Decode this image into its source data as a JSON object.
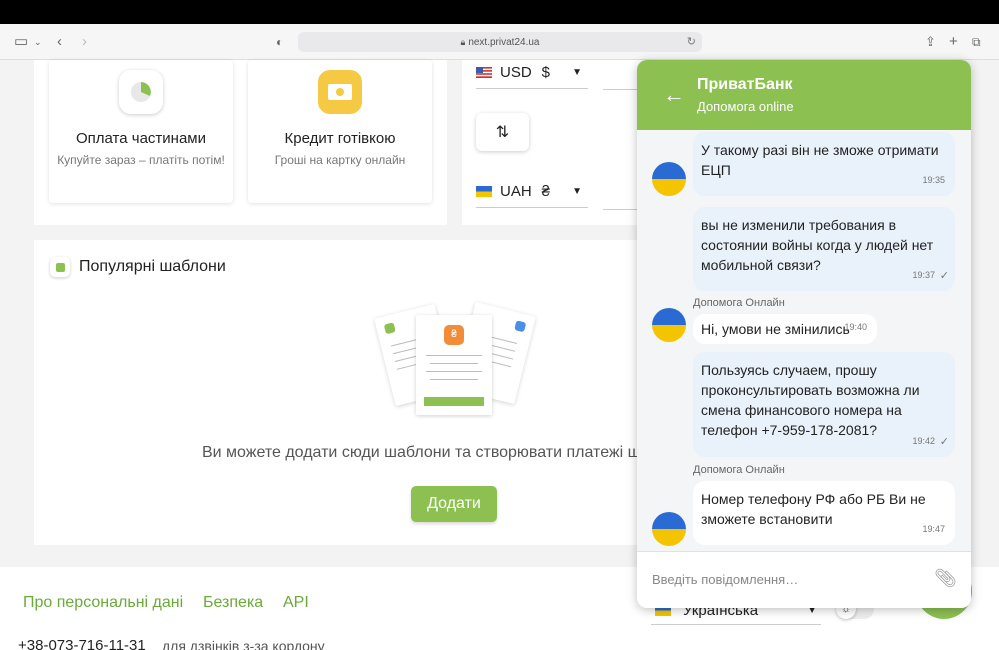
{
  "browser": {
    "url": "next.privat24.ua"
  },
  "cards": [
    {
      "title": "Оплата частинами",
      "subtitle": "Купуйте зараз – платіть потім!"
    },
    {
      "title": "Кредит готівкою",
      "subtitle": "Гроші на картку онлайн"
    }
  ],
  "converter": {
    "from_currency": "USD",
    "from_symbol": "$",
    "to_currency": "UAH",
    "to_symbol": "₴"
  },
  "templates": {
    "title": "Популярні шаблони",
    "empty_text": "Ви можете додати сюди шаблони та створювати платежі ще",
    "add_label": "Додати"
  },
  "footer": {
    "links": [
      "Про персональні дані",
      "Безпека",
      "API"
    ],
    "phone": "+38-073-716-11-31",
    "phone_note": "для дзвінків з-за кордону",
    "language": "Українська"
  },
  "chat": {
    "title": "ПриватБанк",
    "subtitle": "Допомога online",
    "messages": [
      {
        "text": "У такому разі він не зможе отримати ЕЦП",
        "time": "19:35",
        "sender": ""
      },
      {
        "text": "вы не изменили требования в состоянии войны когда у людей нет мобильной связи?",
        "time": "19:37",
        "sender": ""
      },
      {
        "text": "Ні, умови не змінились",
        "time": "19:40",
        "sender": "Допомога Онлайн"
      },
      {
        "text": "Пользуясь случаем, прошу проконсультировать возможна ли смена финансового номера на телефон +7-959-178-2081?",
        "time": "19:42",
        "sender": ""
      },
      {
        "text": "Номер телефону РФ або РБ Ви не зможете встановити",
        "time": "19:47",
        "sender": "Допомога Онлайн"
      }
    ],
    "input_placeholder": "Введіть повідомлення…"
  },
  "colors": {
    "brand_green": "#8cc152",
    "link_green": "#6aaa3a"
  }
}
